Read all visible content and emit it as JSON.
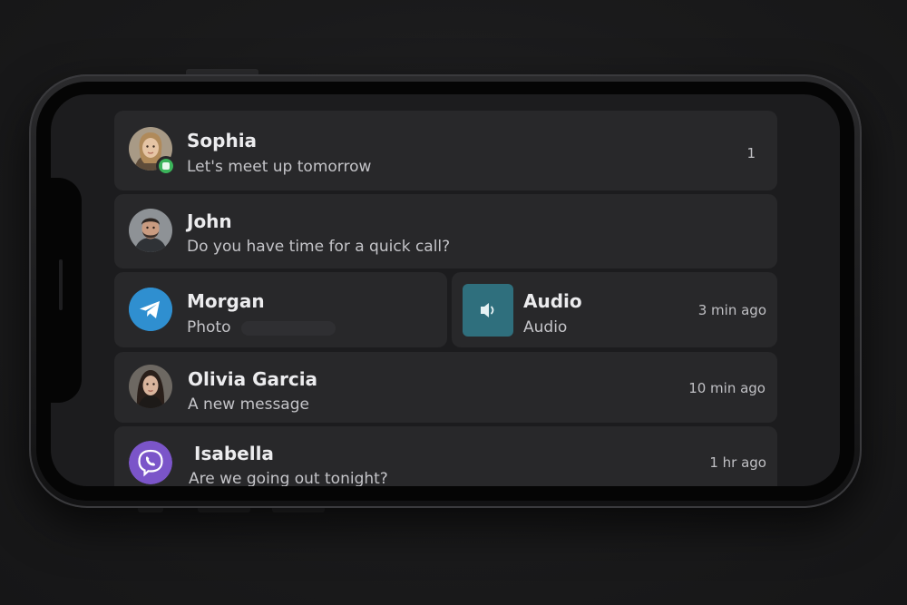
{
  "conversations": [
    {
      "name": "Sophia",
      "message": "Let's meet up tomorrow",
      "meta": "1",
      "avatar": "avatar-woman-blonde",
      "status": "online-badge"
    },
    {
      "name": "John",
      "message": "Do you have time for a quick call?",
      "meta": "",
      "avatar": "avatar-man-beard"
    },
    {
      "name": "Morgan",
      "message": "Photo",
      "meta": "",
      "avatar": "telegram-icon"
    },
    {
      "name": "Audio",
      "message": "Audio",
      "meta": "3 min ago",
      "avatar": "speaker-icon"
    },
    {
      "name": "Olivia Garcia",
      "message": "A new message",
      "meta": "10 min ago",
      "avatar": "avatar-woman-dark-hair"
    },
    {
      "name": "Isabella",
      "message": "Are we going out tonight?",
      "meta": "1 hr ago",
      "avatar": "viber-icon"
    }
  ],
  "colors": {
    "card": "#28282a",
    "screen": "#1c1c1e",
    "online": "#3bb35a",
    "telegram": "#2f8fd0",
    "viber": "#7b55c9",
    "audio_tile": "#2f6f7d"
  }
}
